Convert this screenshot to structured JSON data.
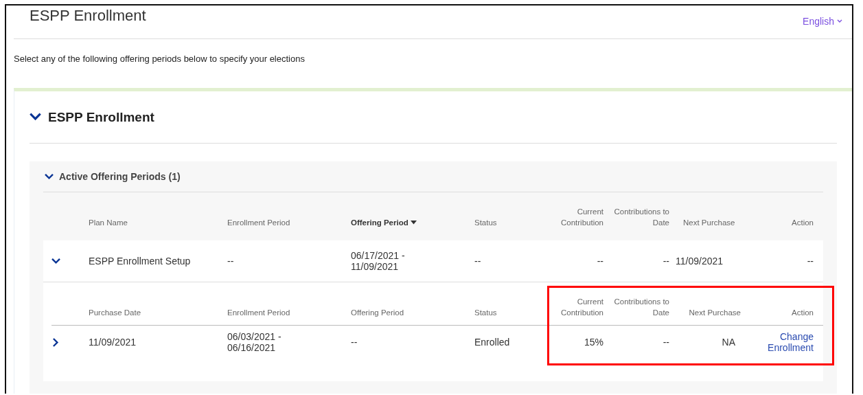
{
  "page": {
    "title": "ESPP Enrollment",
    "language": "English"
  },
  "instructions": "Select any of the following offering periods below to specify your elections",
  "section": {
    "title": "ESPP Enrollment",
    "expanded": true
  },
  "group": {
    "title": "Active Offering Periods (1)",
    "expanded": true
  },
  "table": {
    "columns": [
      {
        "label": "Plan Name",
        "sorted": false
      },
      {
        "label": "Enrollment Period",
        "sorted": false
      },
      {
        "label": "Offering Period",
        "sorted": true
      },
      {
        "label": "Status",
        "sorted": false
      },
      {
        "label": "Current Contribution",
        "sorted": false
      },
      {
        "label": "Contributions to Date",
        "sorted": false
      },
      {
        "label": "Next Purchase",
        "sorted": false
      },
      {
        "label": "Action",
        "sorted": false
      }
    ],
    "rows": [
      {
        "expanded": true,
        "cells": [
          "ESPP Enrollment Setup",
          "--",
          "06/17/2021 - 11/09/2021",
          "--",
          "--",
          "--",
          "11/09/2021",
          "--"
        ],
        "detail": {
          "columns": [
            "Purchase Date",
            "Enrollment Period",
            "Offering Period",
            "Status",
            "Current Contribution",
            "Contributions to Date",
            "Next Purchase",
            "Action"
          ],
          "rows": [
            {
              "expanded": false,
              "cells": [
                "11/09/2021",
                "06/03/2021 - 06/16/2021",
                "--",
                "Enrolled",
                "15%",
                "--",
                "NA"
              ],
              "action": "Change Enrollment"
            }
          ]
        }
      }
    ]
  },
  "annotation": {
    "kind": "box",
    "color": "#ff0000"
  }
}
